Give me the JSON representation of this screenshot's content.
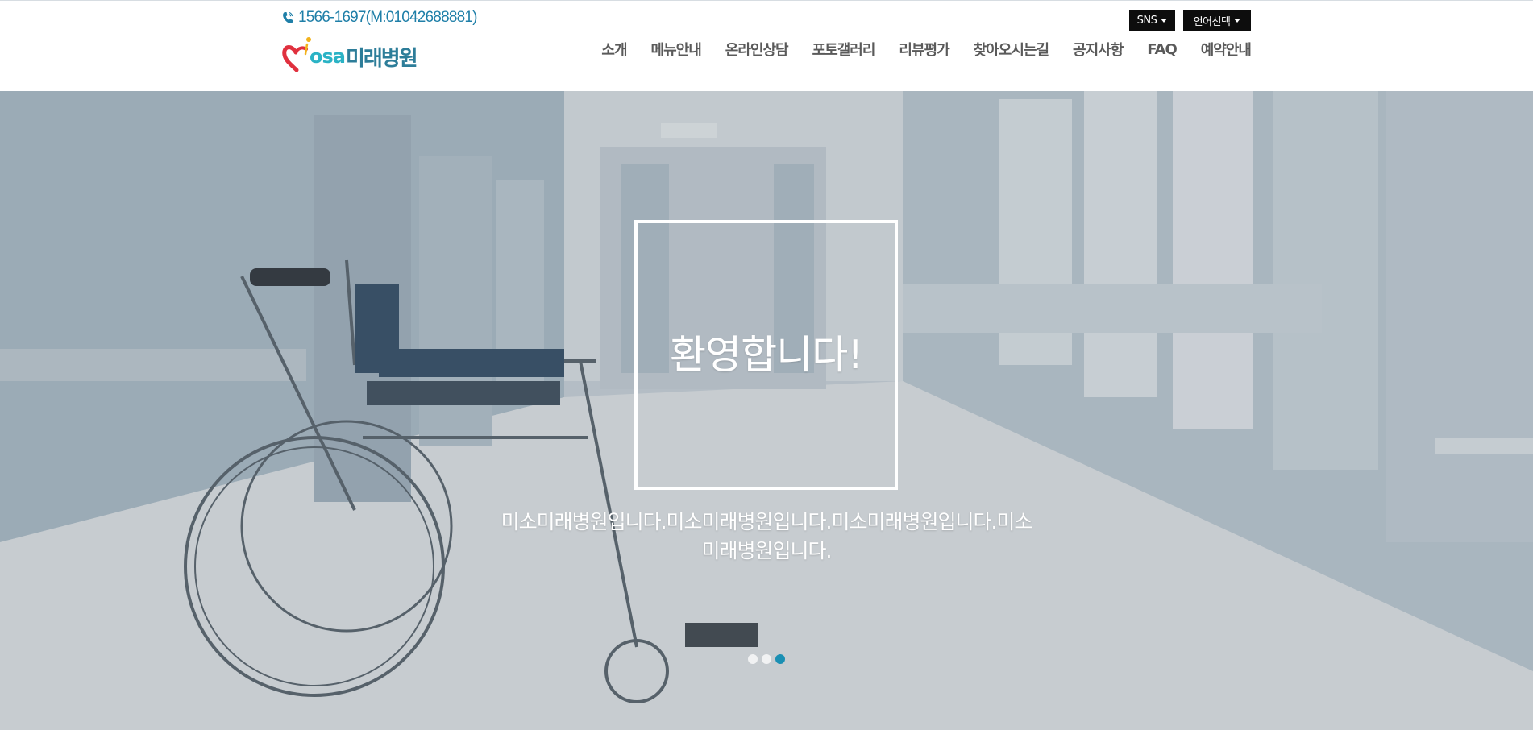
{
  "header": {
    "phone": "1566-1697(M:01042688881)",
    "logo": {
      "latin": "osa",
      "korean": "미래병원"
    },
    "utility": {
      "sns_label": "SNS",
      "language_label": "언어선택"
    },
    "nav": [
      {
        "label": "소개"
      },
      {
        "label": "메뉴안내"
      },
      {
        "label": "온라인상담"
      },
      {
        "label": "포토갤러리"
      },
      {
        "label": "리뷰평가"
      },
      {
        "label": "찾아오시는길"
      },
      {
        "label": "공지사항"
      },
      {
        "label": "FAQ"
      },
      {
        "label": "예약안내"
      }
    ]
  },
  "hero": {
    "heading": "환영합니다!",
    "tagline_line1": "미소미래병원입니다.미소미래병원입니다.미소미래병원입니다.미소",
    "tagline_line2": "미래병원입니다.",
    "slides_total": 3,
    "active_slide": 3
  },
  "icons": {
    "phone": "phone-icon",
    "caret": "caret-down-icon",
    "logo_mark": "heart-logo-icon"
  },
  "colors": {
    "accent": "#1a8fb3",
    "phone_text": "#1f7fa8",
    "logo_red": "#e0303e",
    "logo_teal": "#2bb3c5",
    "logo_dark_teal": "#2d7d99",
    "nav_text": "#5a5a5a",
    "utility_button": "#0d0d0d"
  }
}
